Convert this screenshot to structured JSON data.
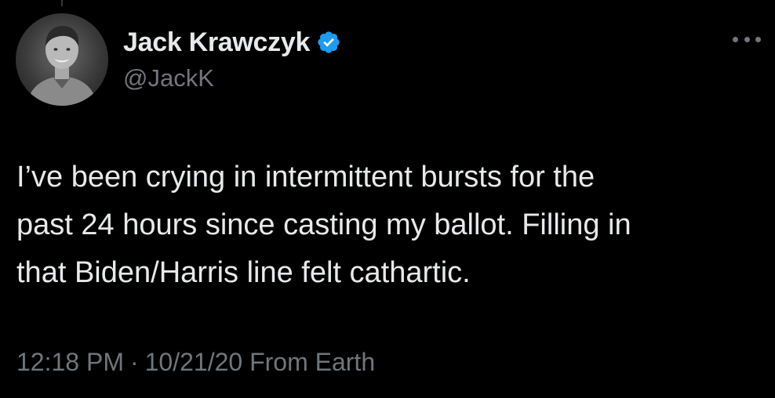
{
  "tweet": {
    "author": {
      "display_name": "Jack Krawczyk",
      "handle": "@JackK",
      "verified": true,
      "verified_icon": "verified-badge-icon",
      "verified_color": "#1d9bf0"
    },
    "text_lines": [
      "I’ve been crying in intermittent bursts for the",
      "past 24 hours since casting my ballot. Filling in",
      "that Biden/Harris line felt cathartic."
    ],
    "time": "12:18 PM",
    "separator": "·",
    "date": "10/21/20",
    "source": "From Earth"
  },
  "icons": {
    "more": "more-options-icon"
  },
  "colors": {
    "background": "#000000",
    "primary_text": "#e7e9ea",
    "secondary_text": "#71767b"
  }
}
